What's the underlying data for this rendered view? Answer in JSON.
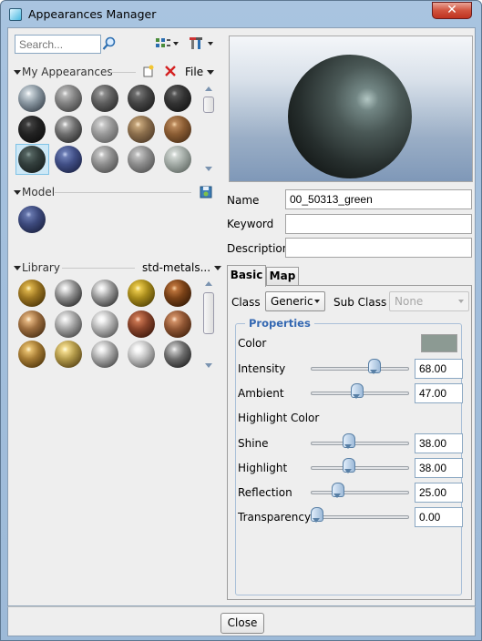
{
  "window": {
    "title": "Appearances Manager",
    "close_glyph": "✕"
  },
  "search": {
    "placeholder": "Search..."
  },
  "my_appearances": {
    "header": "My Appearances",
    "file_menu": "File"
  },
  "model": {
    "header": "Model"
  },
  "library": {
    "header": "Library",
    "dropdown": "std-metals..."
  },
  "form": {
    "name_label": "Name",
    "name_value": "00_50313_green",
    "keyword_label": "Keyword",
    "keyword_value": "",
    "description_label": "Description",
    "description_value": ""
  },
  "tabs": [
    {
      "label": "Basic"
    },
    {
      "label": "Map"
    }
  ],
  "class_row": {
    "class_label": "Class",
    "class_value": "Generic",
    "subclass_label": "Sub Class",
    "subclass_value": "None"
  },
  "properties": {
    "group_label": "Properties",
    "color_label": "Color",
    "color_swatch": "#8c9a93",
    "highlight_color_label": "Highlight Color",
    "sliders": [
      {
        "label": "Intensity",
        "value": "68.00",
        "fraction": 0.68
      },
      {
        "label": "Ambient",
        "value": "47.00",
        "fraction": 0.47
      },
      {
        "label": "Shine",
        "value": "38.00",
        "fraction": 0.38
      },
      {
        "label": "Highlight",
        "value": "38.00",
        "fraction": 0.38
      },
      {
        "label": "Reflection",
        "value": "25.00",
        "fraction": 0.25
      },
      {
        "label": "Transparency",
        "value": "0.00",
        "fraction": 0.0
      }
    ]
  },
  "footer": {
    "close_label": "Close"
  },
  "colors": {
    "accent": "#3468b2",
    "selection": "#cde8f6"
  }
}
